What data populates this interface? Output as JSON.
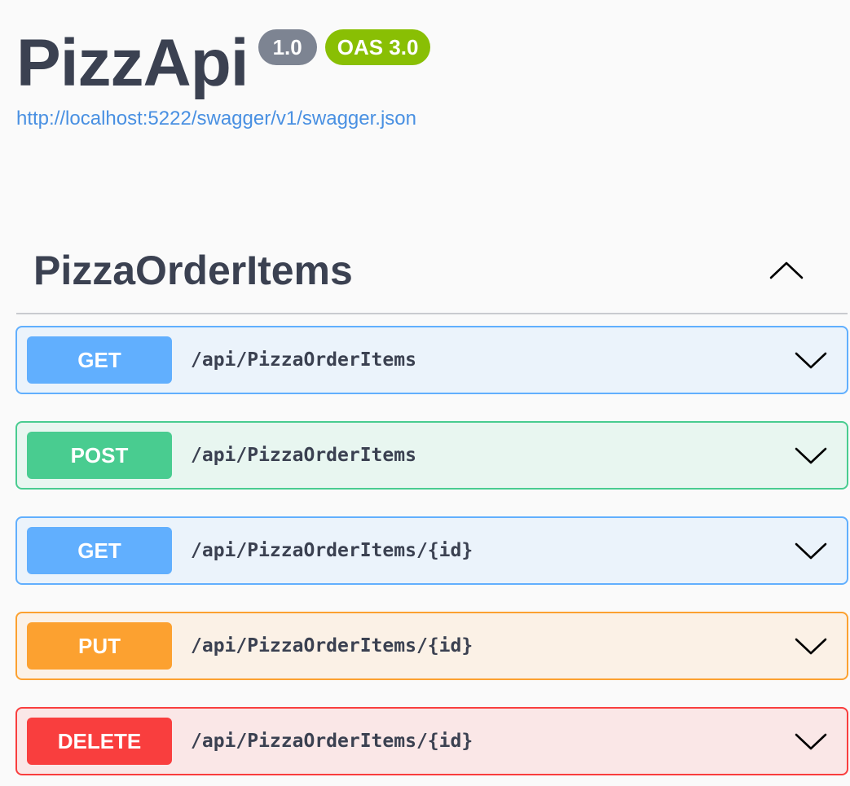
{
  "info": {
    "title": "PizzApi",
    "version": "1.0",
    "oas_version": "OAS 3.0",
    "spec_url": "http://localhost:5222/swagger/v1/swagger.json"
  },
  "tag": {
    "name": "PizzaOrderItems",
    "toggle_icon": "chevron-up-icon"
  },
  "operations": [
    {
      "method": "GET",
      "path": "/api/PizzaOrderItems",
      "color": "#61affe",
      "icon": "chevron-down-icon"
    },
    {
      "method": "POST",
      "path": "/api/PizzaOrderItems",
      "color": "#49cc90",
      "icon": "chevron-down-icon"
    },
    {
      "method": "GET",
      "path": "/api/PizzaOrderItems/{id}",
      "color": "#61affe",
      "icon": "chevron-down-icon"
    },
    {
      "method": "PUT",
      "path": "/api/PizzaOrderItems/{id}",
      "color": "#fca130",
      "icon": "chevron-down-icon"
    },
    {
      "method": "DELETE",
      "path": "/api/PizzaOrderItems/{id}",
      "color": "#f93e3e",
      "icon": "chevron-down-icon"
    }
  ],
  "colors": {
    "text": "#3b4151",
    "link": "#4990e2",
    "version_badge": "#7d8492",
    "oas_badge": "#89bf04"
  }
}
